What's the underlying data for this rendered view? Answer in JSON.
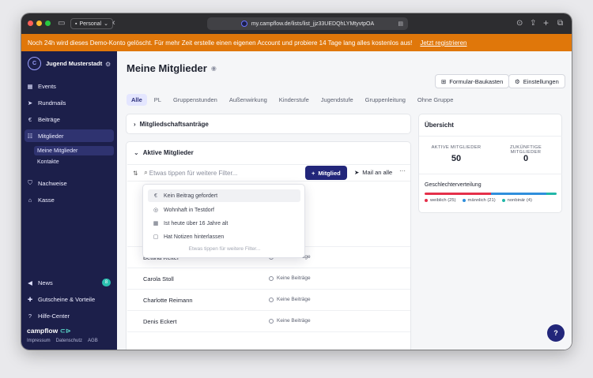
{
  "browser": {
    "profile": "Personal",
    "url": "my.campflow.de/lists/list_jjz33UEDQhLYMtyvtpOA"
  },
  "banner": {
    "text": "Noch 24h wird dieses Demo-Konto gelöscht. Für mehr Zeit erstelle einen eigenen Account und probiere 14 Tage lang alles kostenlos aus!",
    "link": "Jetzt registrieren"
  },
  "sidebar": {
    "org_name": "Jugend Musterstadt",
    "items": [
      {
        "label": "Events",
        "icon": "calendar-icon"
      },
      {
        "label": "Rundmails",
        "icon": "send-icon"
      },
      {
        "label": "Beiträge",
        "icon": "euro-icon"
      },
      {
        "label": "Mitglieder",
        "icon": "users-icon"
      },
      {
        "label": "Nachweise",
        "icon": "shield-icon"
      },
      {
        "label": "Kasse",
        "icon": "bank-icon"
      }
    ],
    "subitems": [
      {
        "label": "Meine Mitglieder"
      },
      {
        "label": "Kontakte"
      }
    ],
    "bottom_items": [
      {
        "label": "News",
        "icon": "megaphone-icon",
        "badge": "8"
      },
      {
        "label": "Gutscheine & Vorteile",
        "icon": "gift-icon"
      },
      {
        "label": "Hilfe-Center",
        "icon": "help-icon"
      }
    ],
    "brand": "campflow",
    "footer_links": [
      "Impressum",
      "Datenschutz",
      "AGB"
    ]
  },
  "page": {
    "title": "Meine Mitglieder",
    "buttons": {
      "form_builder": "Formular-Baukasten",
      "settings": "Einstellungen"
    },
    "tabs": [
      "Alle",
      "PL",
      "Gruppenstunden",
      "Außenwirkung",
      "Kinderstufe",
      "Jugendstufe",
      "Gruppenleitung",
      "Ohne Gruppe"
    ],
    "applications_title": "Mitgliedschaftsanträge",
    "active_title": "Aktive Mitglieder",
    "search_placeholder": "Etwas tippen für weitere Filter...",
    "add_member": "Mitglied",
    "mail_all": "Mail an alle",
    "dropdown": {
      "options": [
        {
          "label": "Kein Beitrag gefordert",
          "icon": "euro-icon"
        },
        {
          "label": "Wohnhaft in Testdorf",
          "icon": "location-pin-icon"
        },
        {
          "label": "Ist heute über 16 Jahre alt",
          "icon": "calendar-icon"
        },
        {
          "label": "Hat Notizen hinterlassen",
          "icon": "note-icon"
        }
      ],
      "hint": "Etwas tippen für weitere Filter..."
    },
    "members": [
      {
        "name": "Bettina Reiter",
        "status": "Keine Beiträge"
      },
      {
        "name": "Carola Stoll",
        "status": "Keine Beiträge"
      },
      {
        "name": "Charlotte Reimann",
        "status": "Keine Beiträge"
      },
      {
        "name": "Denis Eckert",
        "status": "Keine Beiträge"
      }
    ]
  },
  "overview": {
    "title": "Übersicht",
    "active_label": "AKTIVE MITGLIEDER",
    "active_value": "50",
    "future_label": "ZUKÜNFTIGE MITGLIEDER",
    "future_value": "0",
    "gender_title": "Geschlechterverteilung",
    "gender": [
      {
        "label": "weiblich (25)",
        "count": 25,
        "color": "#e5304a"
      },
      {
        "label": "männlich (21)",
        "count": 21,
        "color": "#2f8fdc"
      },
      {
        "label": "nonbinär (4)",
        "count": 4,
        "color": "#21b7a8"
      }
    ]
  },
  "colors": {
    "accent": "#22267a",
    "banner": "#e0770a",
    "sidebar": "#1c1f4a"
  }
}
